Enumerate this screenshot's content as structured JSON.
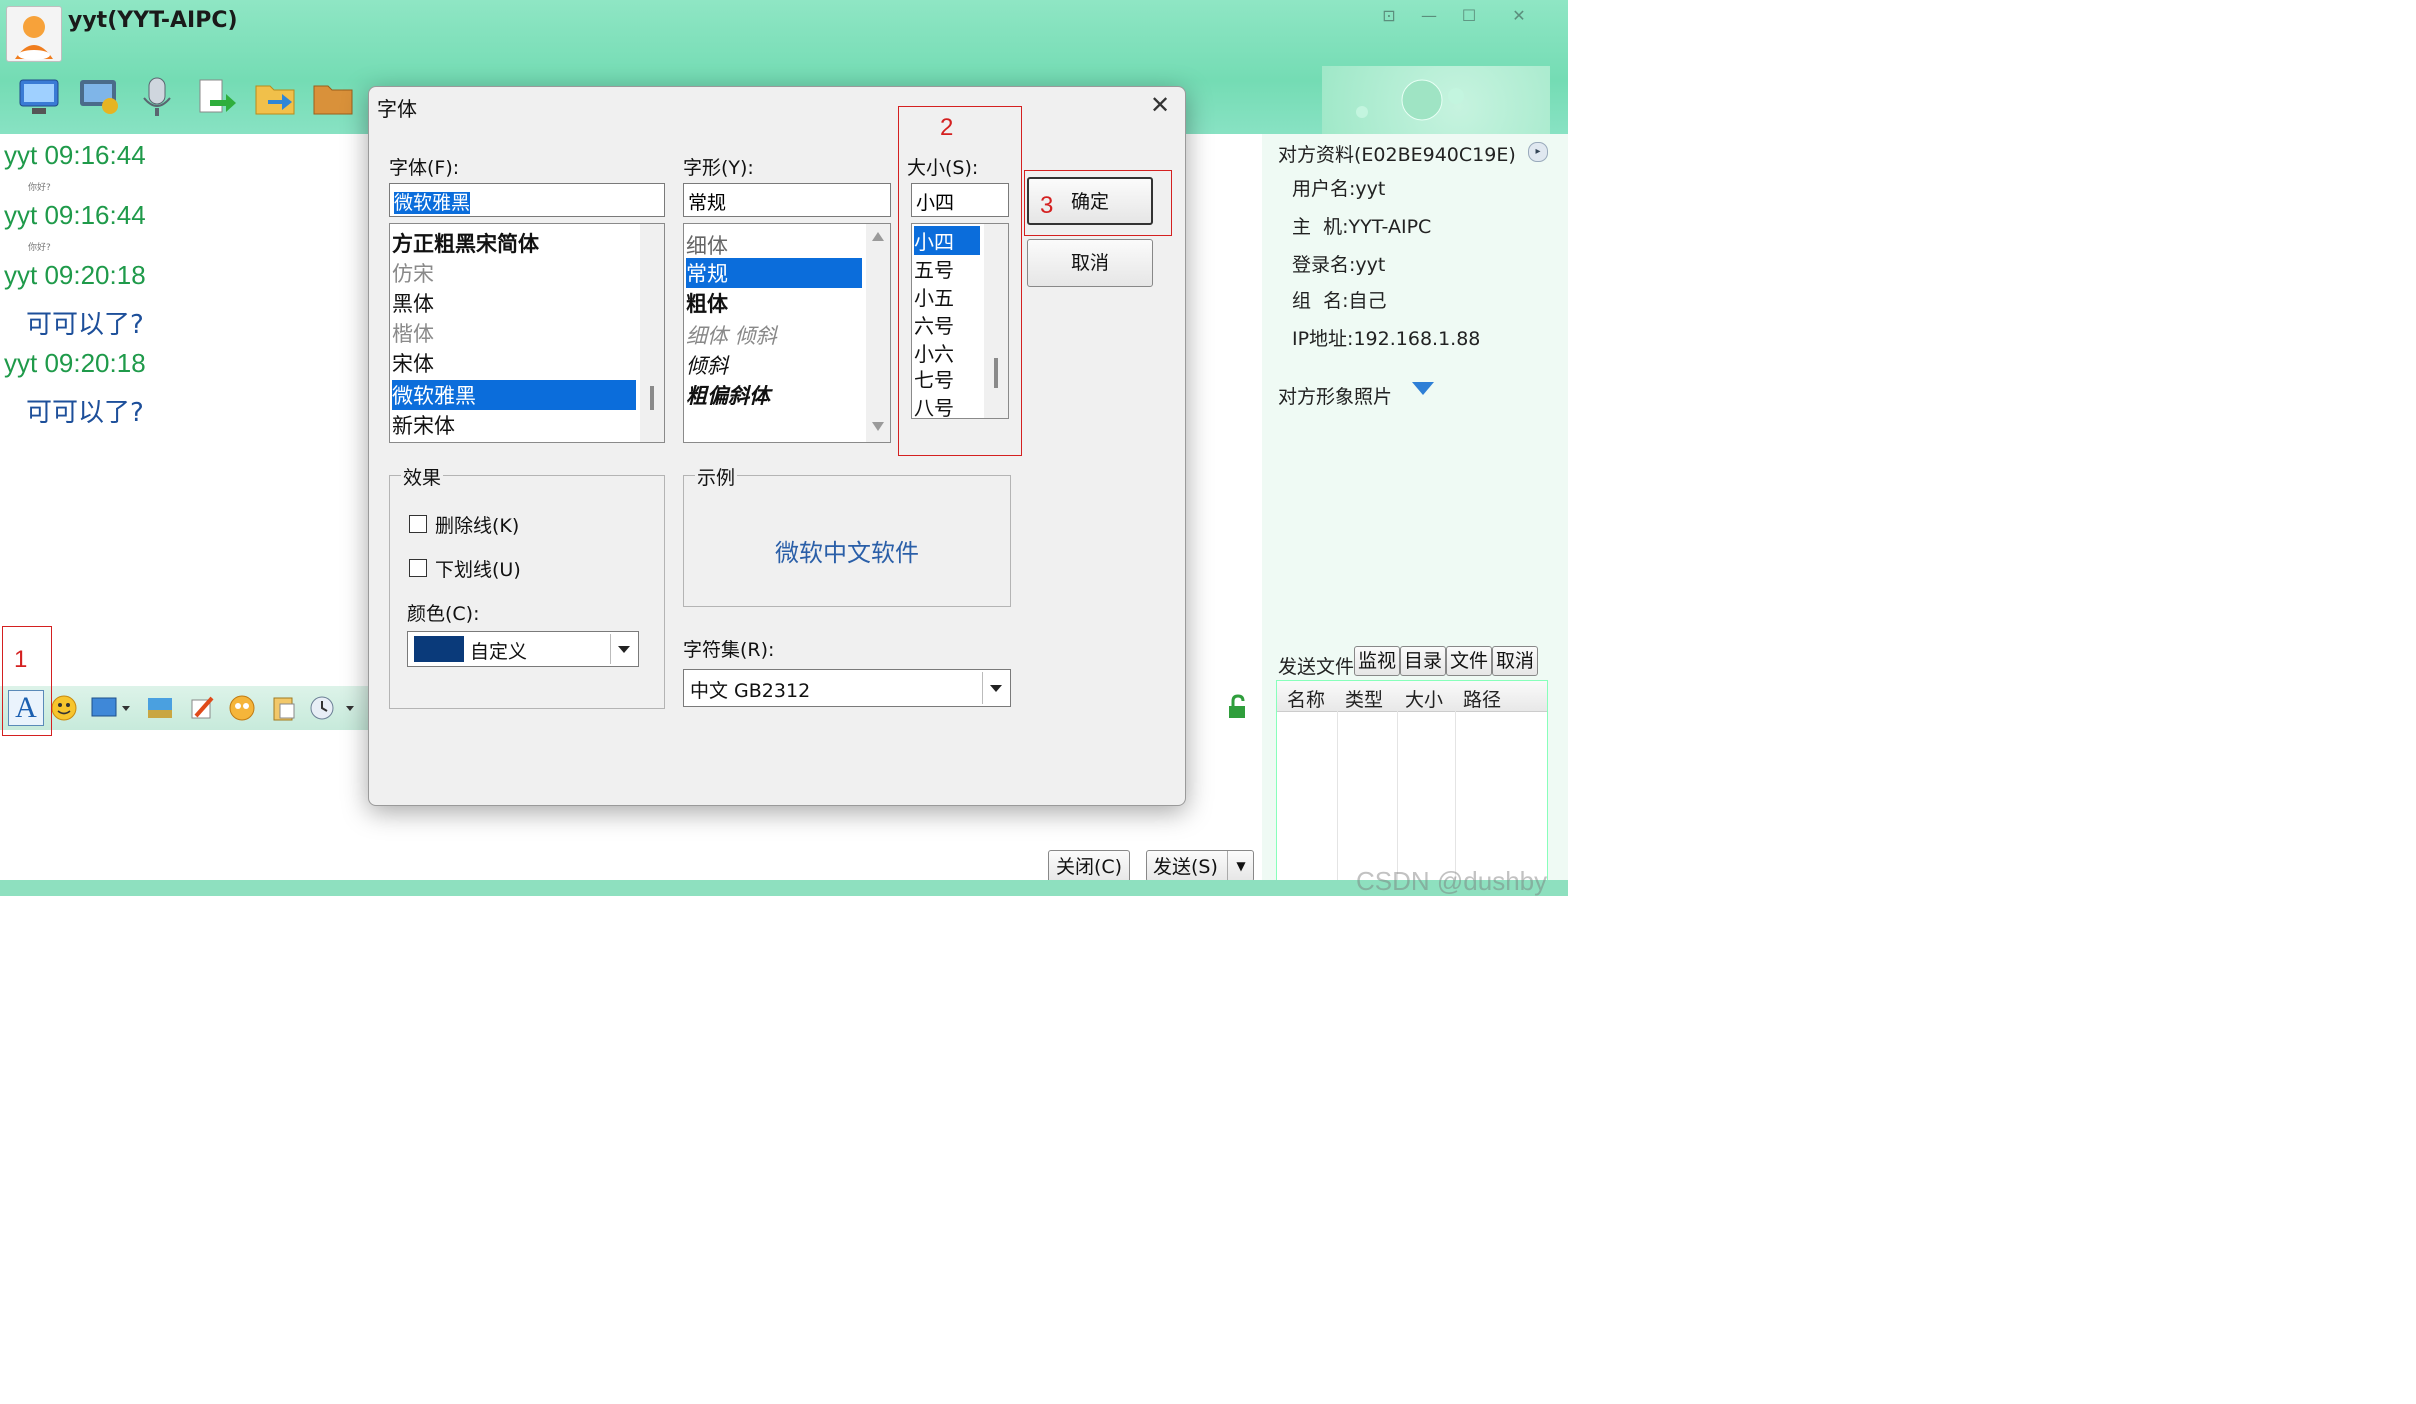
{
  "window": {
    "title": "yyt(YYT-AIPC)",
    "controls": [
      "restore-down-icon",
      "minimize-icon",
      "maximize-icon",
      "close-icon"
    ]
  },
  "messages": [
    {
      "header": "yyt 09:16:44",
      "sub": "你好?"
    },
    {
      "header": "yyt 09:16:44",
      "sub": "你好?"
    },
    {
      "header": "yyt 09:20:18",
      "text": "可可以了?"
    },
    {
      "header": "yyt 09:20:18",
      "text": "可可以了?"
    }
  ],
  "right_panel": {
    "profile_header": "对方资料(E02BE940C19E)",
    "username": "用户名:yyt",
    "host": "主  机:YYT-AIPC",
    "login": "登录名:yyt",
    "group": "组  名:自己",
    "ip": "IP地址:192.168.1.88",
    "photo": "对方形象照片",
    "files_tab": "发送文件",
    "file_tabs": [
      "监视",
      "目录",
      "文件",
      "取消"
    ],
    "file_cols": [
      "名称",
      "类型",
      "大小",
      "路径"
    ]
  },
  "buttons": {
    "close": "关闭(C)",
    "send": "发送(S)"
  },
  "watermark": "CSDN @dushby",
  "dialog": {
    "title": "字体",
    "font_label": "字体(F):",
    "font_value": "微软雅黑",
    "fonts": [
      "方正粗黑宋简体",
      "仿宋",
      "黑体",
      "楷体",
      "宋体",
      "微软雅黑",
      "新宋体"
    ],
    "style_label": "字形(Y):",
    "style_value": "常规",
    "styles": [
      "细体",
      "常规",
      "粗体",
      "细体 倾斜",
      "倾斜",
      "粗偏斜体"
    ],
    "size_label": "大小(S):",
    "size_value": "小四",
    "sizes": [
      "小四",
      "五号",
      "小五",
      "六号",
      "小六",
      "七号",
      "八号"
    ],
    "ok": "确定",
    "cancel": "取消",
    "effects": {
      "title": "效果",
      "strike": "删除线(K)",
      "underline": "下划线(U)",
      "color_label": "颜色(C):",
      "color_value": "自定义",
      "swatch": "#0a3a7a"
    },
    "sample": {
      "title": "示例",
      "text": "微软中文软件"
    },
    "charset": {
      "label": "字符集(R):",
      "value": "中文 GB2312"
    }
  },
  "annotations": [
    "1",
    "2",
    "3"
  ],
  "colors": {
    "accent": "#0b6ddb",
    "annotation": "#d42020",
    "theme": "#74dcb4"
  }
}
